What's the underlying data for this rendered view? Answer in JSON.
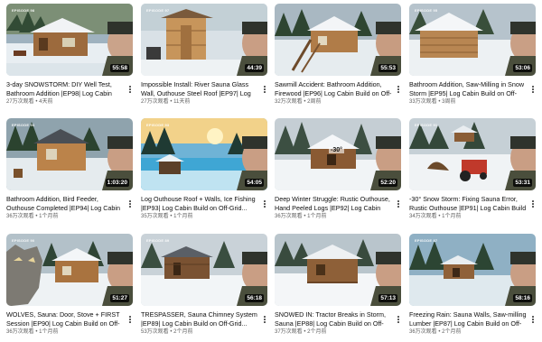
{
  "videos": [
    {
      "title": "3-day SNOWSTORM: DIY Well Test, Bathroom Addition |EP98| Log Cabin Build ...",
      "duration": "55:58",
      "views": "27万次观看",
      "age": "4天前",
      "badge": "EPISODE 98"
    },
    {
      "title": "Impossible Install: River Sauna Glass Wall, Outhouse Steel Roof |EP97| Log Cabin Build...",
      "duration": "44:39",
      "views": "27万次观看",
      "age": "11天前",
      "badge": "EPISODE 97"
    },
    {
      "title": "Sawmill Accident: Bathroom Addition, Firewood |EP96| Log Cabin Build on Off-Grid...",
      "duration": "55:53",
      "views": "32万次观看",
      "age": "2周前",
      "badge": ""
    },
    {
      "title": "Bathroom Addition, Saw-Milling in Snow Storm |EP95| Log Cabin Build on Off-Grid...",
      "duration": "53:06",
      "views": "33万次观看",
      "age": "3周前",
      "badge": "EPISODE 95"
    },
    {
      "title": "Bathroom Addition, Bird Feeder, Outhouse Completed |EP94| Log Cabin Build on Off-...",
      "duration": "1:03:20",
      "views": "36万次观看",
      "age": "1个月前",
      "badge": "EPISODE 94"
    },
    {
      "title": "Log Outhouse Roof + Walls, Ice Fishing |EP93| Log Cabin Build on Off-Grid...",
      "duration": "54:05",
      "views": "35万次观看",
      "age": "1个月前",
      "badge": "EPISODE 93"
    },
    {
      "title": "Deep Winter Struggle: Rustic Outhouse, Hand Peeled Logs |EP92| Log Cabin Build o...",
      "duration": "52:20",
      "views": "36万次观看",
      "age": "1个月前",
      "badge": "",
      "overlay": "-30°"
    },
    {
      "title": "-30° Snow Storm: Fixing Sauna Error, Rustic Outhouse |EP91| Log Cabin Build on Off-...",
      "duration": "53:31",
      "views": "34万次观看",
      "age": "1个月前",
      "badge": "EPISODE 91"
    },
    {
      "title": "WOLVES, Sauna: Door, Stove + FIRST Session |EP90| Log Cabin Build on Off-Grid...",
      "duration": "51:27",
      "views": "36万次观看",
      "age": "1个月前",
      "badge": "EPISODE 90"
    },
    {
      "title": "TRESPASSER, Sauna Chimney System |EP89| Log Cabin Build on Off-Grid...",
      "duration": "56:18",
      "views": "53万次观看",
      "age": "2个月前",
      "badge": "EPISODE 89"
    },
    {
      "title": "SNOWED IN: Tractor Breaks in Storm, Sauna |EP88| Log Cabin Build on Off-Grid...",
      "duration": "57:13",
      "views": "37万次观看",
      "age": "2个月前",
      "badge": ""
    },
    {
      "title": "Freezing Rain: Sauna Walls, Saw-milling Lumber |EP87| Log Cabin Build on Off-Grid...",
      "duration": "58:16",
      "views": "36万次观看",
      "age": "2个月前",
      "badge": "EPISODE 87"
    }
  ],
  "colors": {
    "title": "#0f0f0f",
    "meta": "#606060",
    "duration_bg": "#000000cc"
  },
  "meta_separator": " • "
}
